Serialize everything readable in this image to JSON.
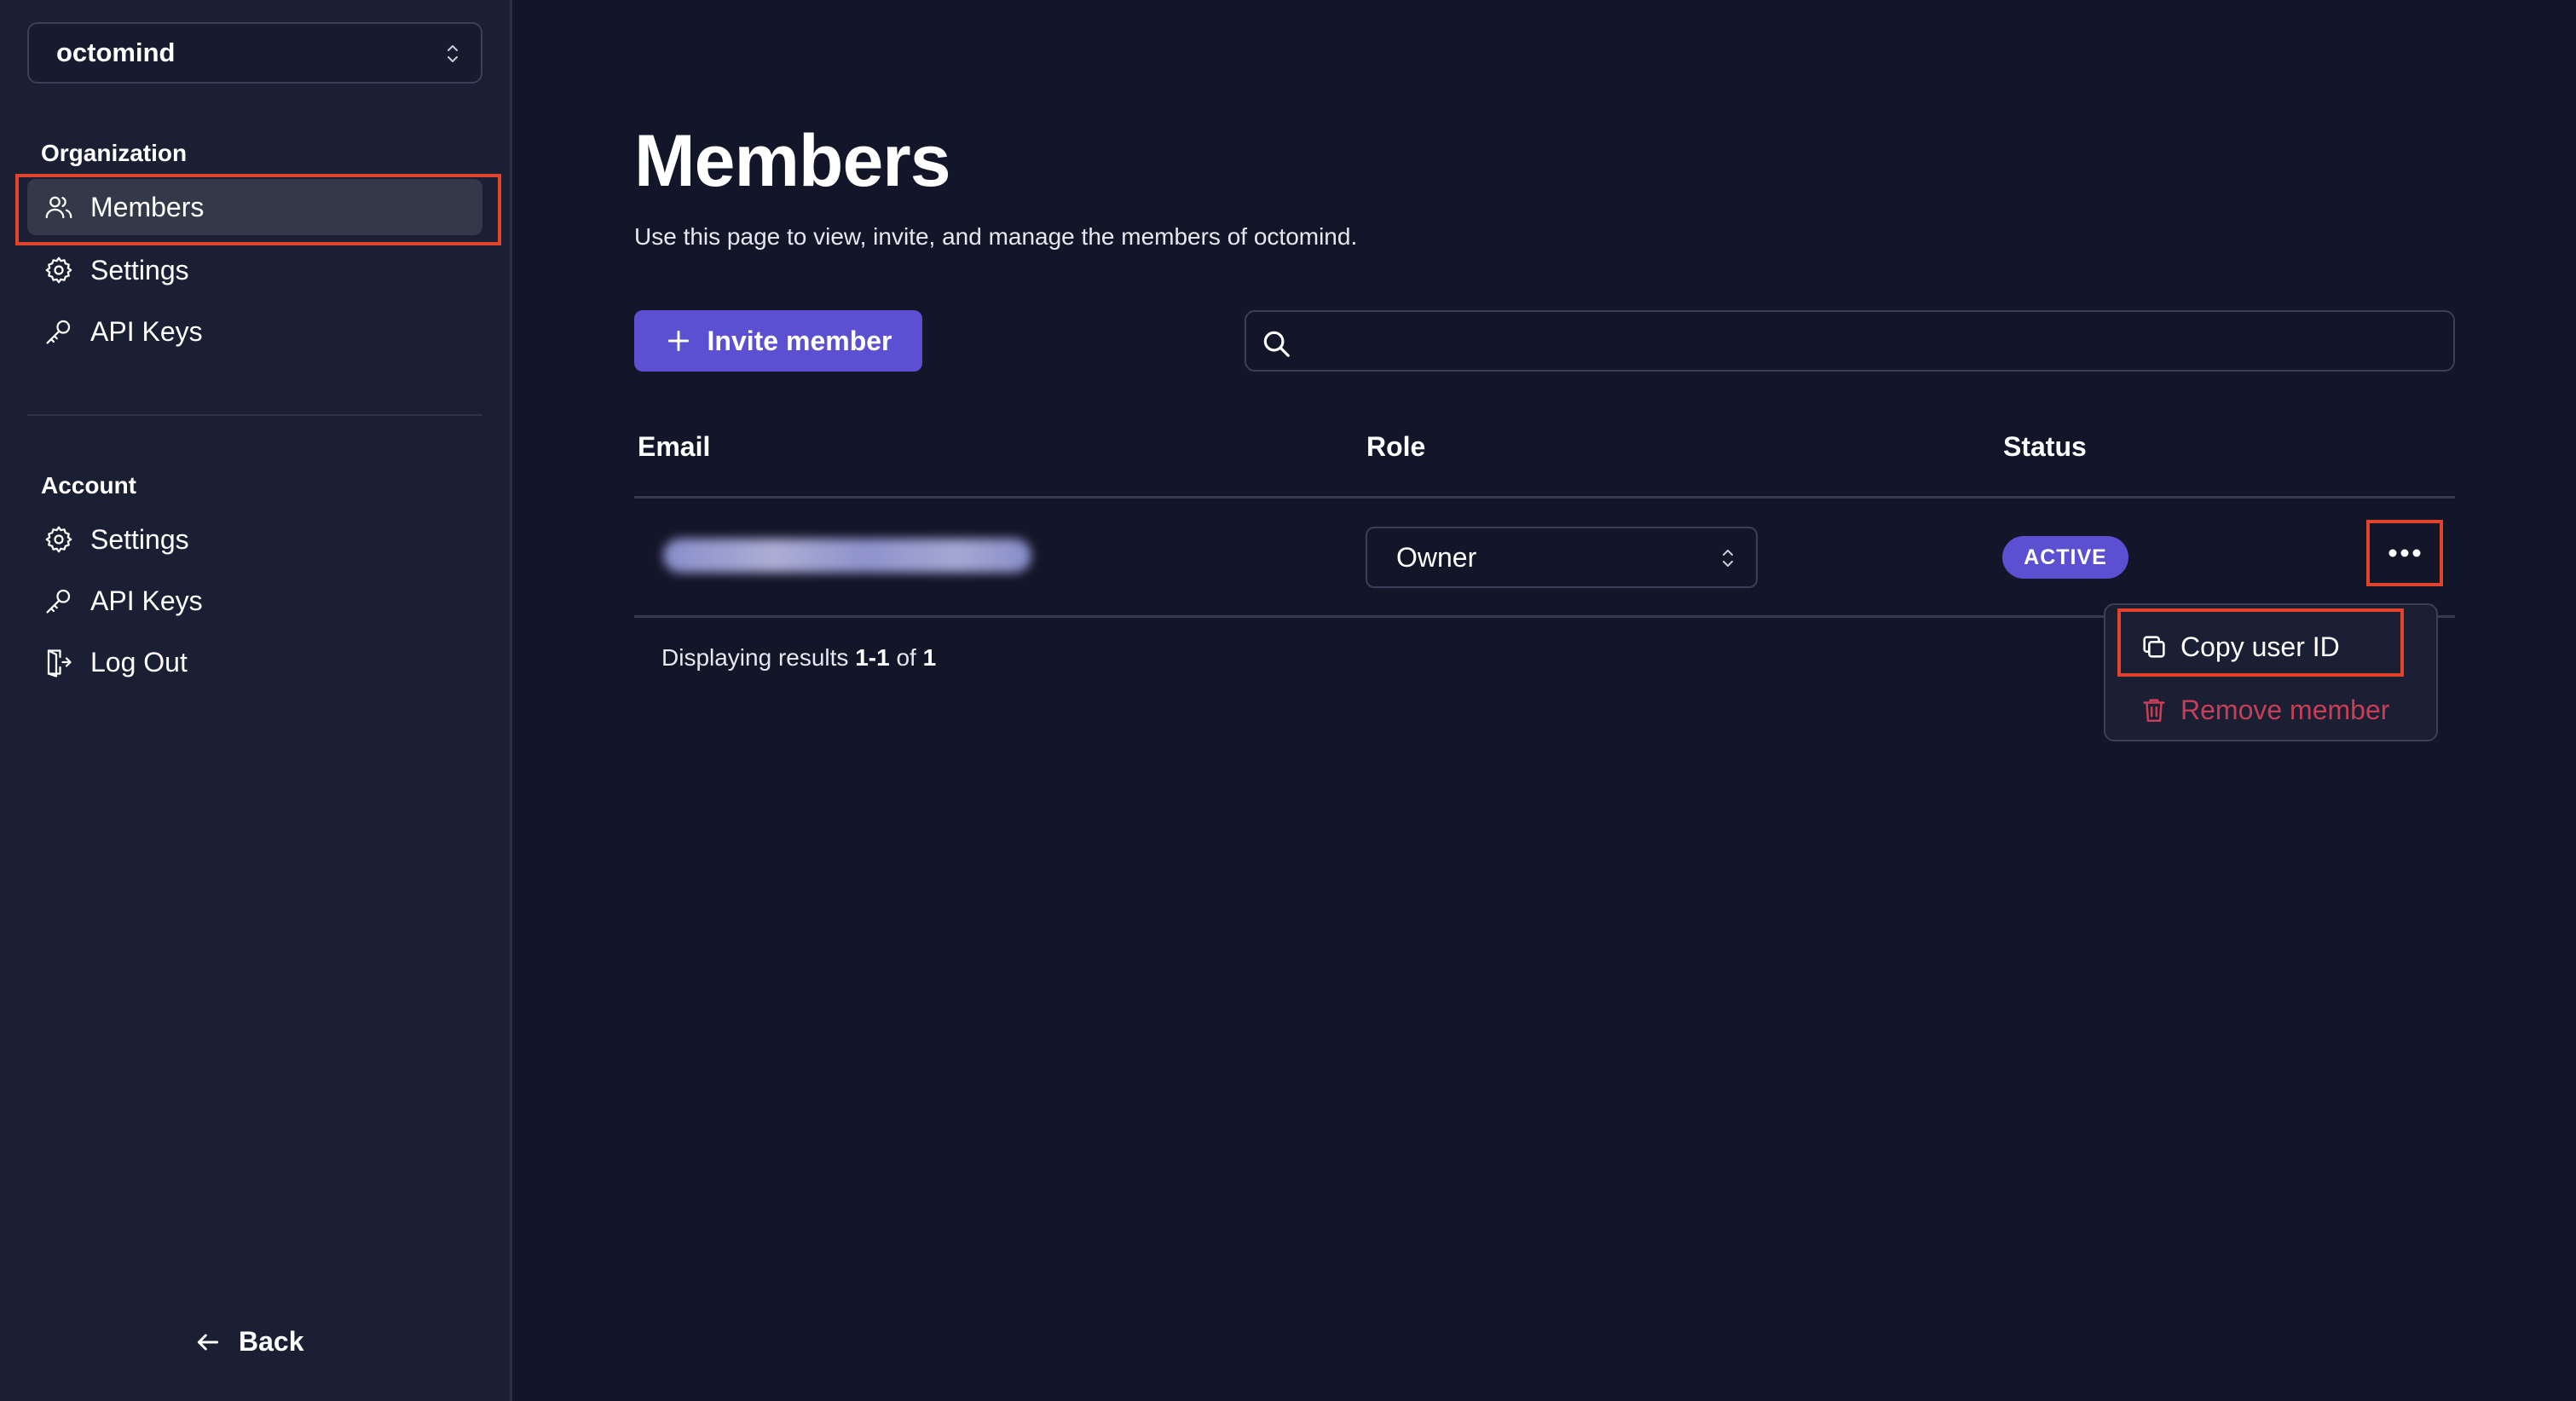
{
  "sidebar": {
    "org_selector": "octomind",
    "sections": [
      {
        "label": "Organization",
        "items": [
          {
            "label": "Members",
            "icon": "users-icon"
          },
          {
            "label": "Settings",
            "icon": "gear-icon"
          },
          {
            "label": "API Keys",
            "icon": "key-icon"
          }
        ]
      },
      {
        "label": "Account",
        "items": [
          {
            "label": "Settings",
            "icon": "gear-icon"
          },
          {
            "label": "API Keys",
            "icon": "key-icon"
          },
          {
            "label": "Log Out",
            "icon": "logout-icon"
          }
        ]
      }
    ],
    "back_label": "Back"
  },
  "main": {
    "title": "Members",
    "description": "Use this page to view, invite, and manage the members of octomind.",
    "invite_button": "Invite member",
    "search": {
      "value": "",
      "placeholder": ""
    },
    "table": {
      "columns": [
        "Email",
        "Role",
        "Status"
      ],
      "rows": [
        {
          "email": "",
          "role": "Owner",
          "status": "ACTIVE"
        }
      ]
    },
    "results": {
      "prefix": "Displaying results",
      "range": "1-1",
      "of": "of",
      "total": "1"
    },
    "row_menu": {
      "copy_user_id": "Copy user ID",
      "remove_member": "Remove member"
    }
  },
  "colors": {
    "background": "#131528",
    "sidebar": "#1a1f33",
    "accent": "#5b50d2",
    "danger": "#c83e56",
    "highlight": "#e0452c"
  }
}
